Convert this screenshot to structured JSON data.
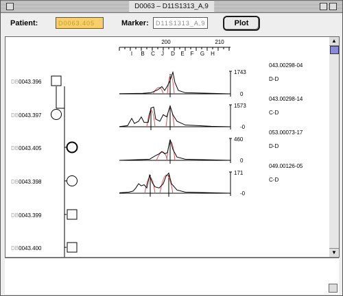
{
  "window": {
    "title": "D0063 – D11S1313_A,9"
  },
  "toolbar": {
    "patient_label": "Patient:",
    "patient_value": "D0063.405",
    "marker_label": "Marker:",
    "marker_value": "D11S1313_A,9",
    "plot_label": "Plot"
  },
  "ruler": {
    "labels": [
      "200",
      "210"
    ],
    "alleles": [
      "I",
      "B",
      "C",
      "J",
      "D",
      "E",
      "F",
      "G",
      "H"
    ]
  },
  "pedigree": {
    "members": [
      {
        "id": "0043.396",
        "sex": "male"
      },
      {
        "id": "0043.397",
        "sex": "female"
      },
      {
        "id": "0043.405",
        "sex": "female",
        "proband": true
      },
      {
        "id": "0043.398",
        "sex": "female"
      },
      {
        "id": "0043.399",
        "sex": "male"
      },
      {
        "id": "0043.400",
        "sex": "male"
      }
    ]
  },
  "traces": [
    {
      "sample": "043.00298-04",
      "genotype": "D-D",
      "ymax": "1743",
      "ymin": "0"
    },
    {
      "sample": "043.00298-14",
      "genotype": "C-D",
      "ymax": "1573",
      "ymin": "-0"
    },
    {
      "sample": "053.00073-17",
      "genotype": "D-D",
      "ymax": "460",
      "ymin": "0"
    },
    {
      "sample": "049.00126-05",
      "genotype": "C-D",
      "ymax": "171",
      "ymin": "-0"
    }
  ],
  "colors": {
    "patient_field": "#f7cf6b",
    "scroll_thumb": "#8a8ad8",
    "fit_curve": "#e05050"
  }
}
